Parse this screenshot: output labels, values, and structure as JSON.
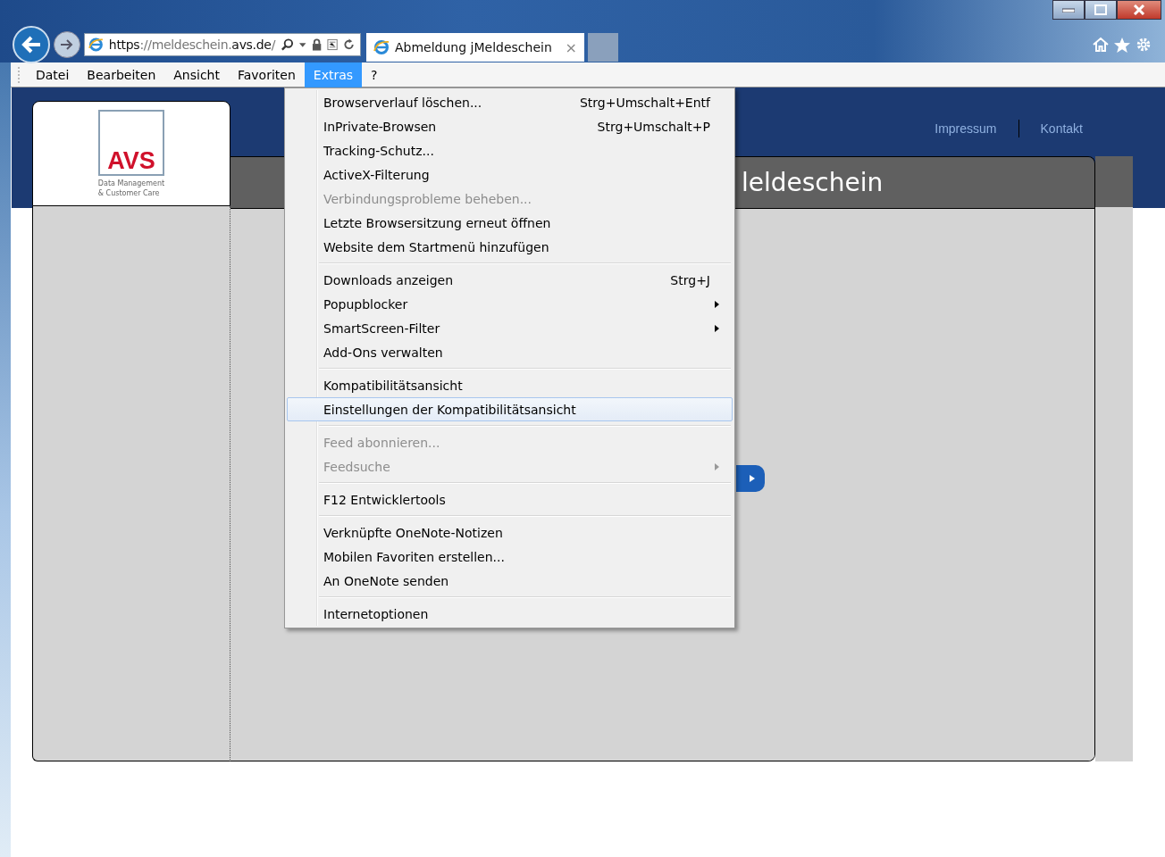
{
  "browser": {
    "address": {
      "scheme": "https",
      "rest": "://meldeschein.",
      "host": "avs.de",
      "tail": "/"
    },
    "tab": {
      "title": "Abmeldung jMeldeschein",
      "close": "×"
    }
  },
  "menubar": [
    {
      "label": "Datei",
      "selected": false
    },
    {
      "label": "Bearbeiten",
      "selected": false
    },
    {
      "label": "Ansicht",
      "selected": false
    },
    {
      "label": "Favoriten",
      "selected": false
    },
    {
      "label": "Extras",
      "selected": true
    },
    {
      "label": "?",
      "selected": false
    }
  ],
  "page": {
    "logo": {
      "mark": "AVS",
      "line1": "Data Management",
      "line2": "& Customer Care"
    },
    "links": [
      "Impressum",
      "Kontakt"
    ],
    "heading": "leldeschein"
  },
  "menu": [
    {
      "kind": "item",
      "label": "Browserverlauf löschen...",
      "shortcut": "Strg+Umschalt+Entf",
      "disabled": false,
      "submenu": false,
      "selected": false
    },
    {
      "kind": "item",
      "label": "InPrivate-Browsen",
      "shortcut": "Strg+Umschalt+P",
      "disabled": false,
      "submenu": false,
      "selected": false
    },
    {
      "kind": "item",
      "label": "Tracking-Schutz...",
      "disabled": false,
      "submenu": false,
      "selected": false
    },
    {
      "kind": "item",
      "label": "ActiveX-Filterung",
      "disabled": false,
      "submenu": false,
      "selected": false
    },
    {
      "kind": "item",
      "label": "Verbindungsprobleme beheben...",
      "disabled": true,
      "submenu": false,
      "selected": false
    },
    {
      "kind": "item",
      "label": "Letzte Browsersitzung erneut öffnen",
      "disabled": false,
      "submenu": false,
      "selected": false
    },
    {
      "kind": "item",
      "label": "Website dem Startmenü hinzufügen",
      "disabled": false,
      "submenu": false,
      "selected": false
    },
    {
      "kind": "separator"
    },
    {
      "kind": "item",
      "label": "Downloads anzeigen",
      "shortcut": "Strg+J",
      "disabled": false,
      "submenu": false,
      "selected": false
    },
    {
      "kind": "item",
      "label": "Popupblocker",
      "disabled": false,
      "submenu": true,
      "selected": false
    },
    {
      "kind": "item",
      "label": "SmartScreen-Filter",
      "disabled": false,
      "submenu": true,
      "selected": false
    },
    {
      "kind": "item",
      "label": "Add-Ons verwalten",
      "disabled": false,
      "submenu": false,
      "selected": false
    },
    {
      "kind": "separator"
    },
    {
      "kind": "item",
      "label": "Kompatibilitätsansicht",
      "disabled": false,
      "submenu": false,
      "selected": false
    },
    {
      "kind": "item",
      "label": "Einstellungen der Kompatibilitätsansicht",
      "disabled": false,
      "submenu": false,
      "selected": true
    },
    {
      "kind": "separator"
    },
    {
      "kind": "item",
      "label": "Feed abonnieren...",
      "disabled": true,
      "submenu": false,
      "selected": false
    },
    {
      "kind": "item",
      "label": "Feedsuche",
      "disabled": true,
      "submenu": true,
      "selected": false
    },
    {
      "kind": "separator"
    },
    {
      "kind": "item",
      "label": "F12 Entwicklertools",
      "disabled": false,
      "submenu": false,
      "selected": false
    },
    {
      "kind": "separator"
    },
    {
      "kind": "item",
      "label": "Verknüpfte OneNote-Notizen",
      "disabled": false,
      "submenu": false,
      "selected": false
    },
    {
      "kind": "item",
      "label": "Mobilen Favoriten erstellen...",
      "disabled": false,
      "submenu": false,
      "selected": false
    },
    {
      "kind": "item",
      "label": "An OneNote senden",
      "disabled": false,
      "submenu": false,
      "selected": false
    },
    {
      "kind": "separator"
    },
    {
      "kind": "item",
      "label": "Internetoptionen",
      "disabled": false,
      "submenu": false,
      "selected": false
    }
  ]
}
